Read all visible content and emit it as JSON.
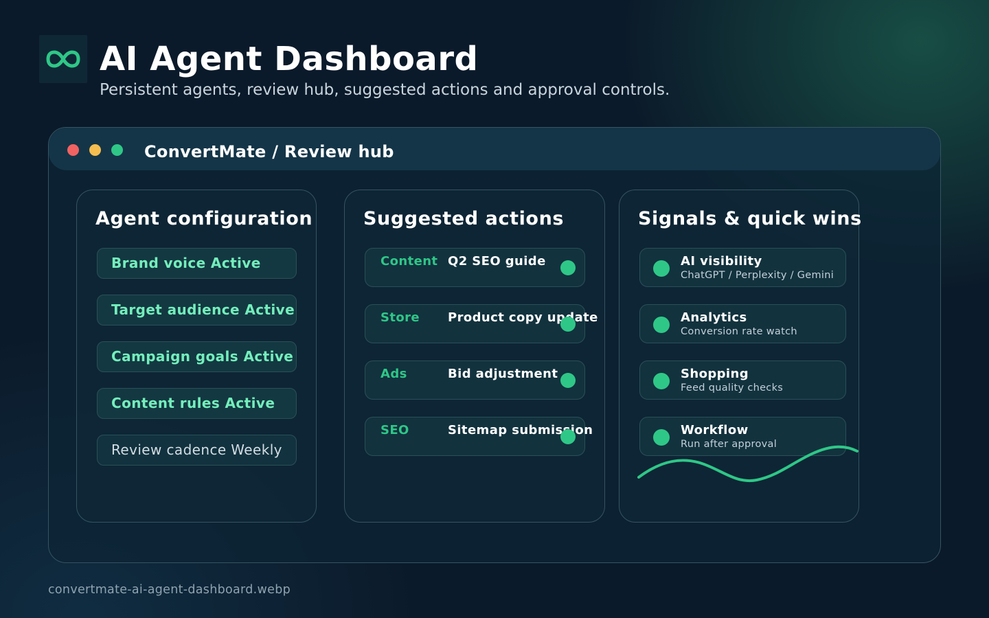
{
  "header": {
    "logo_icon": "infinity-icon",
    "title": "AI Agent Dashboard",
    "subtitle": "Persistent agents, review hub, suggested actions and approval controls."
  },
  "window": {
    "title": "ConvertMate / Review hub",
    "controls": [
      "close",
      "minimize",
      "maximize"
    ]
  },
  "agent_config": {
    "title": "Agent configuration",
    "items": [
      {
        "label": "Brand voice Active",
        "state": "active"
      },
      {
        "label": "Target audience Active",
        "state": "active"
      },
      {
        "label": "Campaign goals Active",
        "state": "active"
      },
      {
        "label": "Content rules Active",
        "state": "active"
      },
      {
        "label": "Review cadence Weekly",
        "state": "inactive"
      }
    ]
  },
  "suggested_actions": {
    "title": "Suggested actions",
    "items": [
      {
        "tag": "Content",
        "text": "Q2 SEO guide"
      },
      {
        "tag": "Store",
        "text": "Product copy update"
      },
      {
        "tag": "Ads",
        "text": "Bid adjustment"
      },
      {
        "tag": "SEO",
        "text": "Sitemap submission"
      }
    ]
  },
  "signals": {
    "title": "Signals & quick wins",
    "items": [
      {
        "title": "AI visibility",
        "subtitle": "ChatGPT / Perplexity / Gemini"
      },
      {
        "title": "Analytics",
        "subtitle": "Conversion rate watch"
      },
      {
        "title": "Shopping",
        "subtitle": "Feed quality checks"
      },
      {
        "title": "Workflow",
        "subtitle": "Run after approval"
      }
    ]
  },
  "footer": {
    "filename": "convertmate-ai-agent-dashboard.webp"
  },
  "colors": {
    "accent": "#2fc787",
    "active_text": "#74eebc",
    "background": "#0b1a2a",
    "close_dot": "#f26262",
    "minimize_dot": "#f5bd4f",
    "maximize_dot": "#2fc787"
  }
}
